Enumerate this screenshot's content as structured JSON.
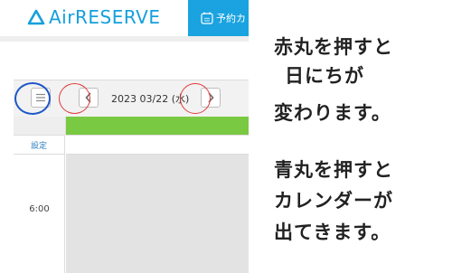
{
  "header": {
    "logo_text_air": "Air",
    "logo_text_reserve": "RESERVE",
    "tab_label": "予約カ",
    "brand_color": "#1aa3e0"
  },
  "toolbar": {
    "menu_icon": "hamburger-menu-icon",
    "prev_icon": "chevron-left-icon",
    "next_icon": "chevron-right-icon",
    "date": "2023 03/22 (水)"
  },
  "grid": {
    "settings_label": "設定",
    "times": [
      "6:00"
    ],
    "staff_bar_color": "#7ac943"
  },
  "annotations": {
    "red_note": [
      "赤丸を押すと",
      "日にちが",
      "変わります。"
    ],
    "blue_note": [
      "青丸を押すと",
      "カレンダーが",
      "出てきます。"
    ],
    "red_color": "#e23a3a",
    "blue_color": "#1e56c8"
  }
}
